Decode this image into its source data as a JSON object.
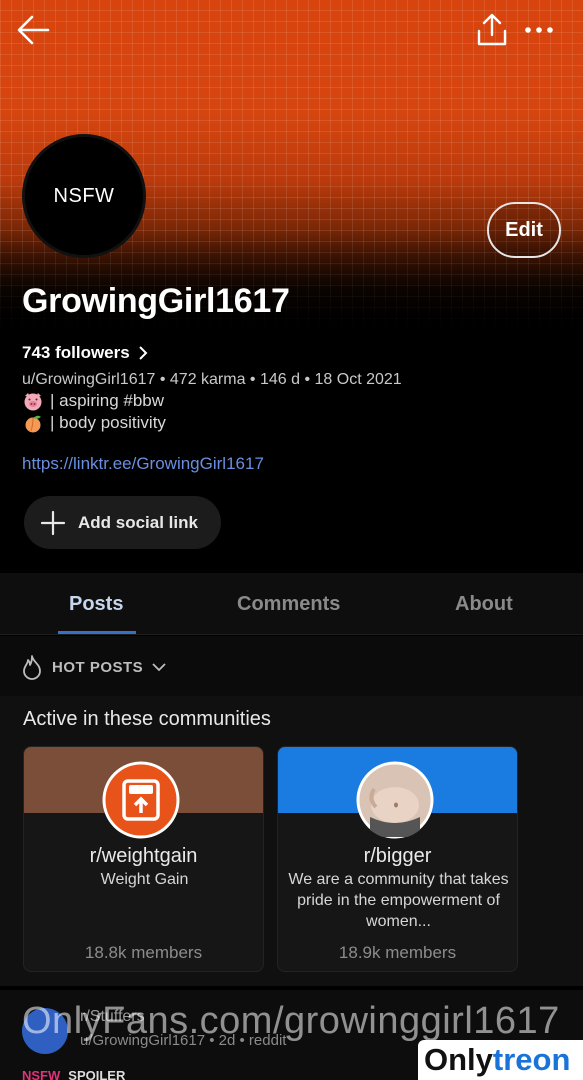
{
  "header": {
    "back_icon": "arrow-left-icon",
    "share_icon": "share-icon",
    "more_icon": "more-horizontal-icon"
  },
  "profile": {
    "avatar_text": "NSFW",
    "edit_label": "Edit",
    "display_name": "GrowingGirl1617",
    "followers": "743 followers",
    "meta": "u/GrowingGirl1617 • 472 karma • 146 d • 18 Oct 2021",
    "bio_line1": "| aspiring #bbw",
    "bio_line2": "| body positivity",
    "link": "https://linktr.ee/GrowingGirl1617",
    "add_social_label": "Add social link"
  },
  "tabs": [
    {
      "label": "Posts",
      "active": true
    },
    {
      "label": "Comments",
      "active": false
    },
    {
      "label": "About",
      "active": false
    }
  ],
  "sort": {
    "label": "HOT POSTS"
  },
  "communities": {
    "title": "Active in these communities",
    "items": [
      {
        "name": "r/weightgain",
        "description": "Weight Gain",
        "members": "18.8k members",
        "banner_color": "#7a4e38"
      },
      {
        "name": "r/bigger",
        "description": "We are a community that takes pride in the empowerment of women...",
        "members": "18.9k members",
        "banner_color": "#1a7ce0"
      }
    ]
  },
  "post": {
    "subreddit": "r/Stuffers",
    "meta": "u/GrowingGirl1617 • 2d • reddit",
    "tag_nsfw": "NSFW",
    "tag_spoiler": "SPOILER"
  },
  "watermark": {
    "text": "OnlyFans.com/growinggirl1617",
    "brand_a": "Only",
    "brand_b": "treon"
  },
  "colors": {
    "banner": "#d8440e",
    "accent": "#3a6fc6",
    "link": "#6a8fe0"
  }
}
